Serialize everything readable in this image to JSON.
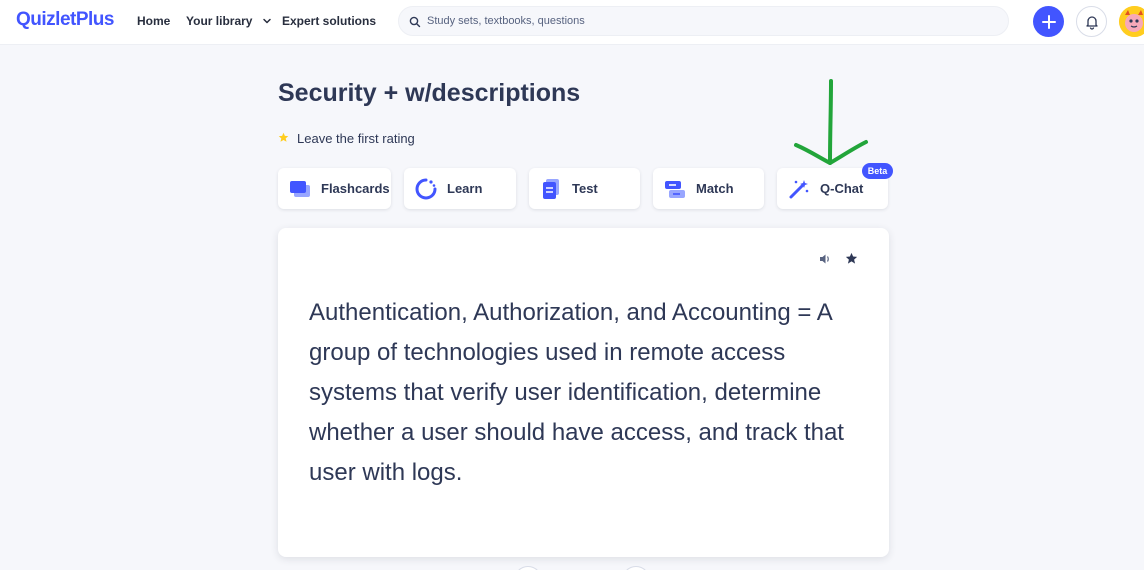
{
  "brand": {
    "logo_text": "QuizletPlus",
    "accent": "#4255ff"
  },
  "nav": {
    "home": "Home",
    "library": "Your library",
    "expert": "Expert solutions"
  },
  "search": {
    "placeholder": "Study sets, textbooks, questions",
    "value": ""
  },
  "set": {
    "title": "Security + w/descriptions",
    "rating_text": "Leave the first rating"
  },
  "modes": [
    {
      "label": "Flashcards",
      "icon": "flashcards-icon"
    },
    {
      "label": "Learn",
      "icon": "learn-icon"
    },
    {
      "label": "Test",
      "icon": "test-icon"
    },
    {
      "label": "Match",
      "icon": "match-icon"
    },
    {
      "label": "Q-Chat",
      "icon": "magic-wand-icon",
      "badge": "Beta"
    }
  ],
  "card": {
    "text": "Authentication, Authorization, and Accounting = A group of technologies used in remote access systems that verify user identification, determine whether a user should have access, and track that user with logs."
  },
  "annotation": {
    "color": "#22a53a"
  }
}
